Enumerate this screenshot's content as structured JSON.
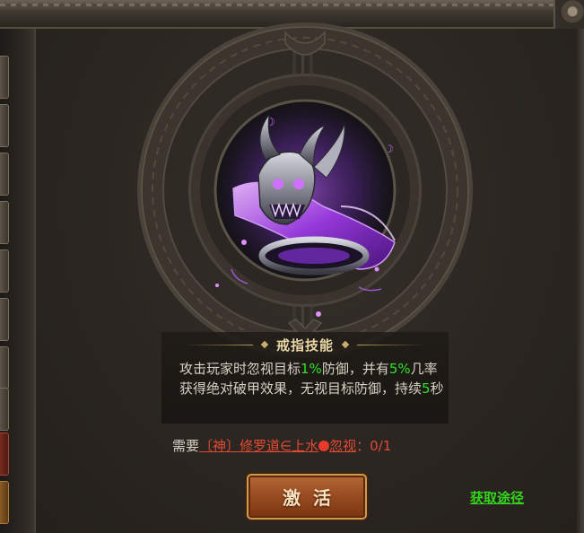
{
  "skill": {
    "title": "戒指技能",
    "desc_1": "攻击玩家时忽视目标",
    "desc_pct1": "1%",
    "desc_2": "防御，并有",
    "desc_pct2": "5%",
    "desc_3": "几率获得绝对破甲效果，无视目标防御，持续",
    "desc_dur": "5",
    "desc_4": "秒"
  },
  "requirement": {
    "prefix": "需要",
    "item": "〔神〕修罗道∈上水",
    "item_suffix": "忽视",
    "progress": "：0/1"
  },
  "buttons": {
    "activate": "激活",
    "acquire": "获取途径"
  },
  "colors": {
    "highlight": "#2ee12a",
    "requirement": "#e24a34",
    "button": "#9a4d21",
    "ring_glow": "#b040ff"
  }
}
